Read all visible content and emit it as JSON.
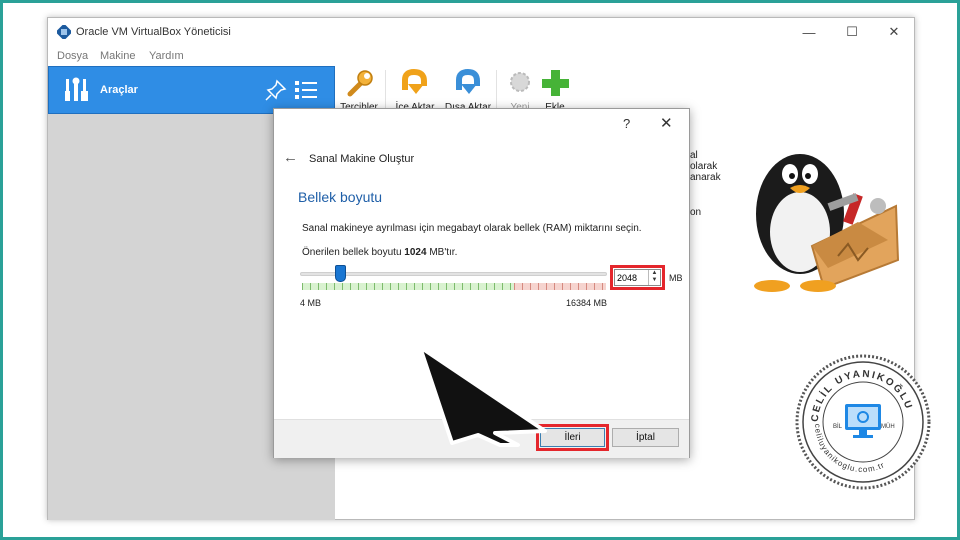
{
  "window": {
    "title": "Oracle VM VirtualBox Yöneticisi",
    "controls": [
      "—",
      "☐",
      "✕"
    ]
  },
  "menu": [
    "Dosya",
    "Makine",
    "Yardım"
  ],
  "sidebar": {
    "tools_label": "Araçlar"
  },
  "toolbar": [
    {
      "label": "Tercihler",
      "icon": "preferences-icon",
      "enabled": true
    },
    {
      "label": "İçe Aktar",
      "icon": "import-icon",
      "enabled": true
    },
    {
      "label": "Dışa Aktar",
      "icon": "export-icon",
      "enabled": true
    },
    {
      "label": "Yeni",
      "icon": "new-icon",
      "enabled": false
    },
    {
      "label": "Ekle",
      "icon": "add-icon",
      "enabled": true
    }
  ],
  "background_text": [
    "al",
    "olarak",
    "anarak",
    "on"
  ],
  "dialog": {
    "help": "?",
    "close": "✕",
    "back": "←",
    "title": "Sanal Makine Oluştur",
    "heading": "Bellek boyutu",
    "description": "Sanal makineye ayrılması için megabayt olarak bellek (RAM) miktarını seçin.",
    "recommended_prefix": "Önerilen bellek boyutu ",
    "recommended_value": "1024",
    "recommended_suffix": " MB'tır.",
    "memory": {
      "value": "2048",
      "unit": "MB",
      "min_label": "4 MB",
      "max_label": "16384 MB",
      "min": 4,
      "max": 16384,
      "slider_value": 2048
    },
    "buttons": {
      "next": "İleri",
      "cancel": "İptal"
    }
  },
  "seal": {
    "name": "CELİL UYANIKOĞLU",
    "left": "BİL",
    "right": "MÜH",
    "url": "celiluyanikoglu.com.tr"
  },
  "colors": {
    "accent": "#2f8de5",
    "highlight": "#e4262c",
    "heading": "#1f5fa8",
    "frame": "#2aa198"
  }
}
